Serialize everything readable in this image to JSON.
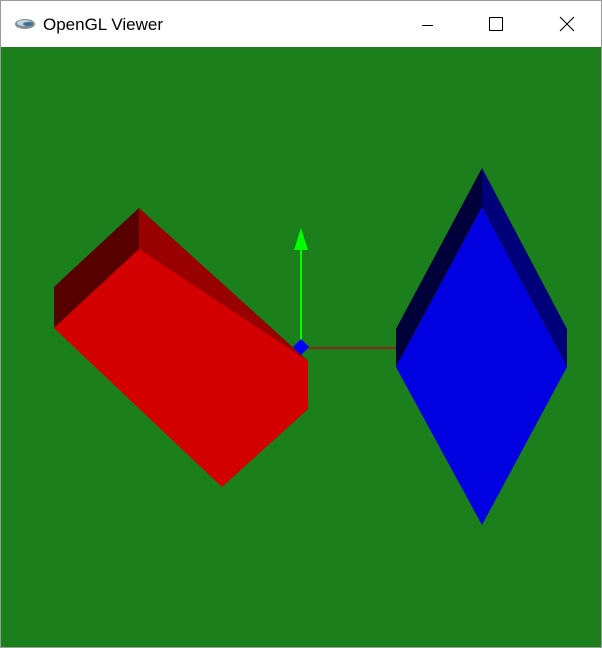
{
  "window": {
    "title": "OpenGL Viewer",
    "app_icon": "opengl-app-icon"
  },
  "titlebar_controls": {
    "minimize_icon": "minimize-icon",
    "maximize_icon": "maximize-icon",
    "close_icon": "close-icon"
  },
  "scene": {
    "background_color": "#1b7f1b",
    "red_box": {
      "front_color": "#d20000",
      "top_color": "#990000",
      "side_color": "#560000"
    },
    "blue_shape": {
      "front_color": "#0000e0",
      "right_color": "#00007a",
      "left_color": "#00003a"
    },
    "axes": {
      "y_axis_color": "#00ff00",
      "x_axis_color": "#8b2a1a",
      "origin_marker_color": "#0000ff"
    }
  }
}
